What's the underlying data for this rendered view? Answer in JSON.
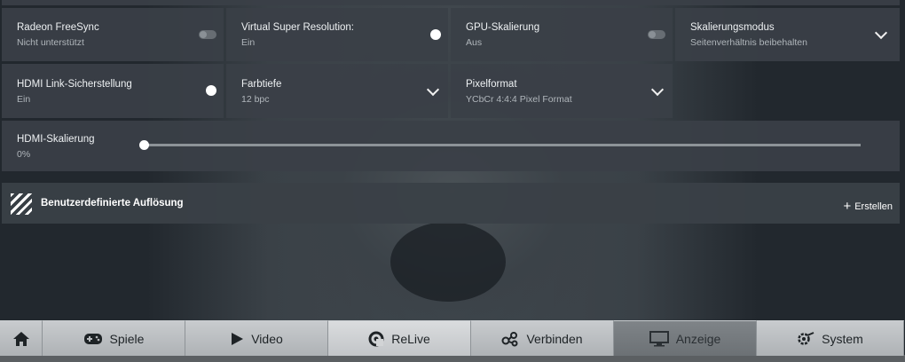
{
  "settings": {
    "freesync": {
      "title": "Radeon FreeSync",
      "value": "Nicht unterstützt",
      "toggle": "off"
    },
    "vsr": {
      "title": "Virtual Super Resolution:",
      "value": "Ein",
      "toggle": "on"
    },
    "gpu_scaling": {
      "title": "GPU-Skalierung",
      "value": "Aus",
      "toggle": "off"
    },
    "scaling_mode": {
      "title": "Skalierungsmodus",
      "value": "Seitenverhältnis beibehalten"
    },
    "hdmi_link": {
      "title": "HDMI Link-Sicherstellung",
      "value": "Ein",
      "toggle": "on"
    },
    "color_depth": {
      "title": "Farbtiefe",
      "value": "12 bpc"
    },
    "pixel_format": {
      "title": "Pixelformat",
      "value": "YCbCr 4:4:4 Pixel Format"
    },
    "hdmi_scaling": {
      "title": "HDMI-Skalierung",
      "value": "0%",
      "percent": 0
    }
  },
  "custom_resolution": {
    "title": "Benutzerdefinierte Auflösung",
    "create_label": "Erstellen"
  },
  "nav": {
    "tabs": [
      {
        "label": "Spiele",
        "icon": "gamepad-icon"
      },
      {
        "label": "Video",
        "icon": "play-icon"
      },
      {
        "label": "ReLive",
        "icon": "relive-icon"
      },
      {
        "label": "Verbinden",
        "icon": "connect-icon"
      },
      {
        "label": "Anzeige",
        "icon": "monitor-icon",
        "active": true
      },
      {
        "label": "System",
        "icon": "gear-icon"
      }
    ]
  }
}
